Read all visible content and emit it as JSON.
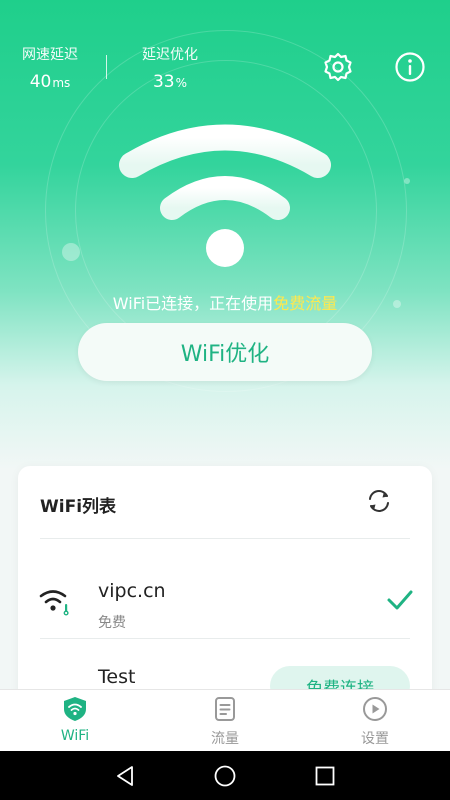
{
  "stats": {
    "latency": {
      "label": "网速延迟",
      "value": "40",
      "unit": "ms"
    },
    "optimization": {
      "label": "延迟优化",
      "value": "33",
      "unit": "%"
    }
  },
  "status": {
    "prefix": "WiFi已连接，正在使用",
    "highlight": "免费流量"
  },
  "optimize_button": "WiFi优化",
  "wifi_list": {
    "title": "WiFi列表",
    "networks": [
      {
        "name": "vipc.cn",
        "sub": "免费",
        "connected": true
      },
      {
        "name": "Test",
        "action": "免费连接"
      }
    ]
  },
  "tabs": [
    {
      "label": "WiFi",
      "icon": "wifi-shield-icon",
      "active": true
    },
    {
      "label": "流量",
      "icon": "document-icon",
      "active": false
    },
    {
      "label": "设置",
      "icon": "play-circle-icon",
      "active": false
    }
  ],
  "colors": {
    "accent": "#1fb383",
    "hero_top": "#1fcf8b",
    "highlight": "#ffe94d"
  }
}
